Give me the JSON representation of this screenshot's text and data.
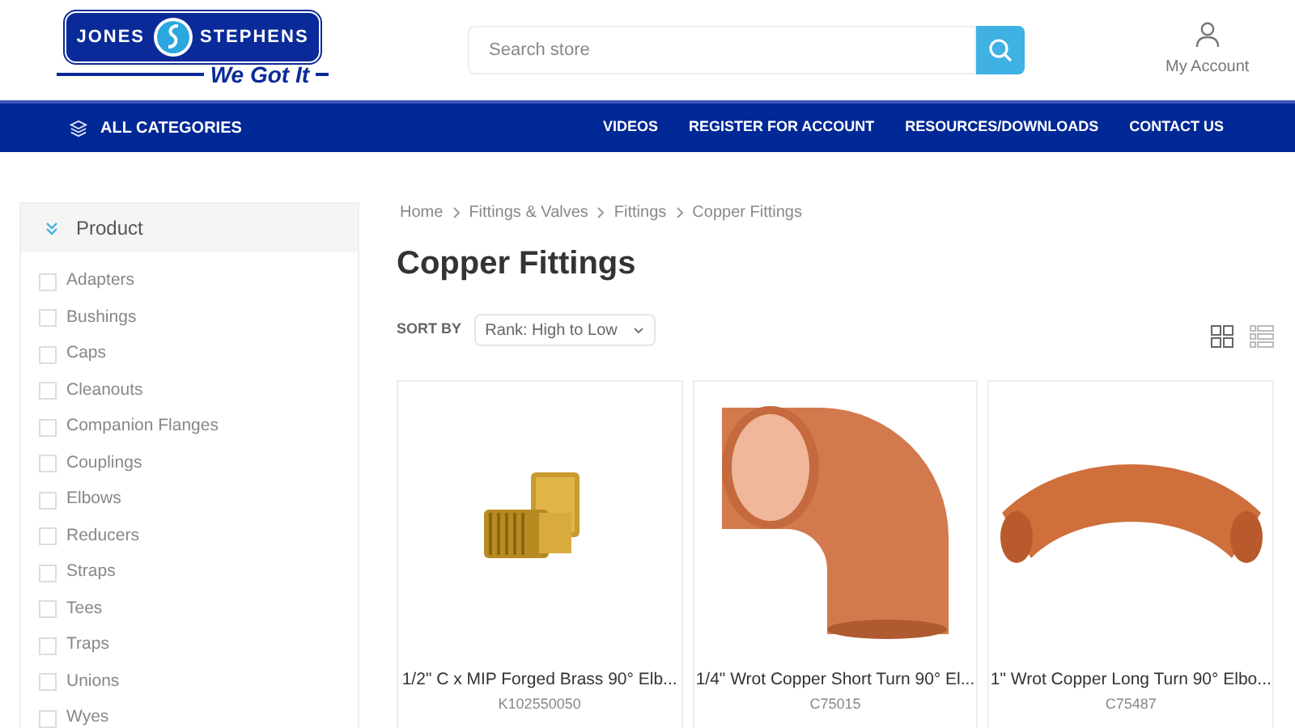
{
  "logo": {
    "left_word": "JONES",
    "right_word": "STEPHENS",
    "tagline": "We Got It"
  },
  "search": {
    "placeholder": "Search store"
  },
  "account": {
    "label": "My Account"
  },
  "nav": {
    "categories": "ALL CATEGORIES",
    "links": [
      "VIDEOS",
      "REGISTER FOR ACCOUNT",
      "RESOURCES/DOWNLOADS",
      "CONTACT US"
    ]
  },
  "filter": {
    "title": "Product",
    "expanded": true,
    "options": [
      {
        "label": "Adapters",
        "checked": false
      },
      {
        "label": "Bushings",
        "checked": false
      },
      {
        "label": "Caps",
        "checked": false
      },
      {
        "label": "Cleanouts",
        "checked": false
      },
      {
        "label": "Companion Flanges",
        "checked": false
      },
      {
        "label": "Couplings",
        "checked": false
      },
      {
        "label": "Elbows",
        "checked": false
      },
      {
        "label": "Reducers",
        "checked": false
      },
      {
        "label": "Straps",
        "checked": false
      },
      {
        "label": "Tees",
        "checked": false
      },
      {
        "label": "Traps",
        "checked": false
      },
      {
        "label": "Unions",
        "checked": false
      },
      {
        "label": "Wyes",
        "checked": false
      }
    ]
  },
  "breadcrumb": [
    "Home",
    "Fittings & Valves",
    "Fittings",
    "Copper Fittings"
  ],
  "page_title": "Copper Fittings",
  "sort": {
    "label": "SORT BY",
    "value": "Rank: High to Low"
  },
  "view_modes": [
    {
      "kind": "grid",
      "selected": true
    },
    {
      "kind": "list",
      "selected": false
    }
  ],
  "products": [
    {
      "kind": "brass",
      "name": "1/2\" C x MIP Forged Brass 90° Elb...",
      "sku": "K102550050"
    },
    {
      "kind": "short",
      "name": "1/4\" Wrot Copper Short Turn 90° El...",
      "sku": "C75015"
    },
    {
      "kind": "long",
      "name": "1\" Wrot Copper Long Turn 90° Elbo...",
      "sku": "C75487"
    }
  ]
}
